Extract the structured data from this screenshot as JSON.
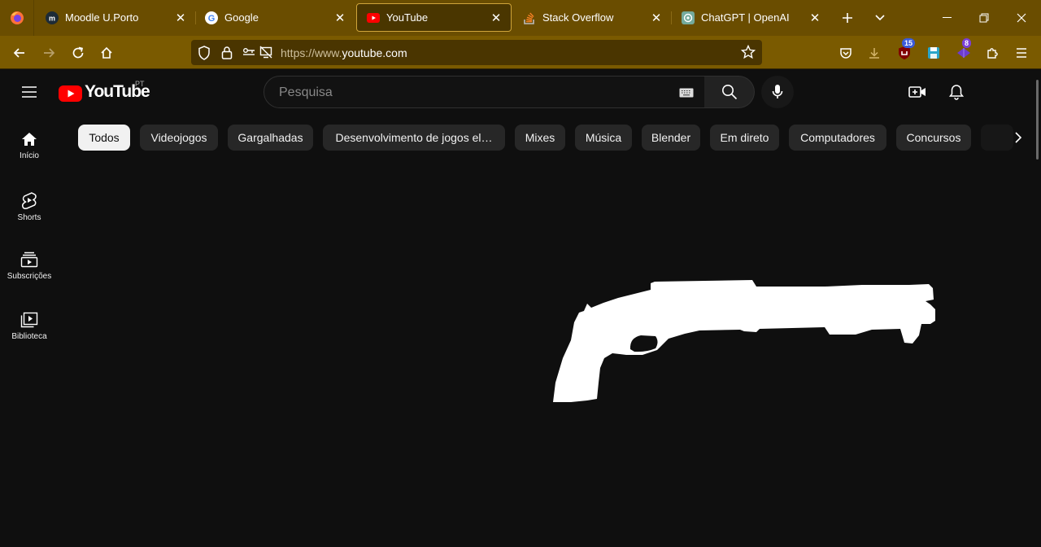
{
  "browser": {
    "tabs": [
      {
        "label": "Moodle U.Porto",
        "favicon": "moodle-icon"
      },
      {
        "label": "Google",
        "favicon": "google-icon"
      },
      {
        "label": "YouTube",
        "favicon": "youtube-icon",
        "active": true
      },
      {
        "label": "Stack Overflow",
        "favicon": "stackoverflow-icon"
      },
      {
        "label": "ChatGPT | OpenAI",
        "favicon": "openai-icon"
      }
    ],
    "url_prefix": "https://www.",
    "url_host": "youtube.com",
    "extension_badges": {
      "ublock": "15",
      "ext2": "8"
    },
    "theme_color": "#6a4d00"
  },
  "youtube": {
    "logo_text": "YouTube",
    "country_code": "PT",
    "search_placeholder": "Pesquisa",
    "sidebar": [
      {
        "label": "Início",
        "icon": "home-icon"
      },
      {
        "label": "Shorts",
        "icon": "shorts-icon"
      },
      {
        "label": "Subscrições",
        "icon": "subscriptions-icon"
      },
      {
        "label": "Biblioteca",
        "icon": "library-icon"
      }
    ],
    "chips": [
      "Todos",
      "Videojogos",
      "Gargalhadas",
      "Desenvolvimento de jogos el…",
      "Mixes",
      "Música",
      "Blender",
      "Em direto",
      "Computadores",
      "Concursos"
    ],
    "accent_red": "#ff0000"
  }
}
